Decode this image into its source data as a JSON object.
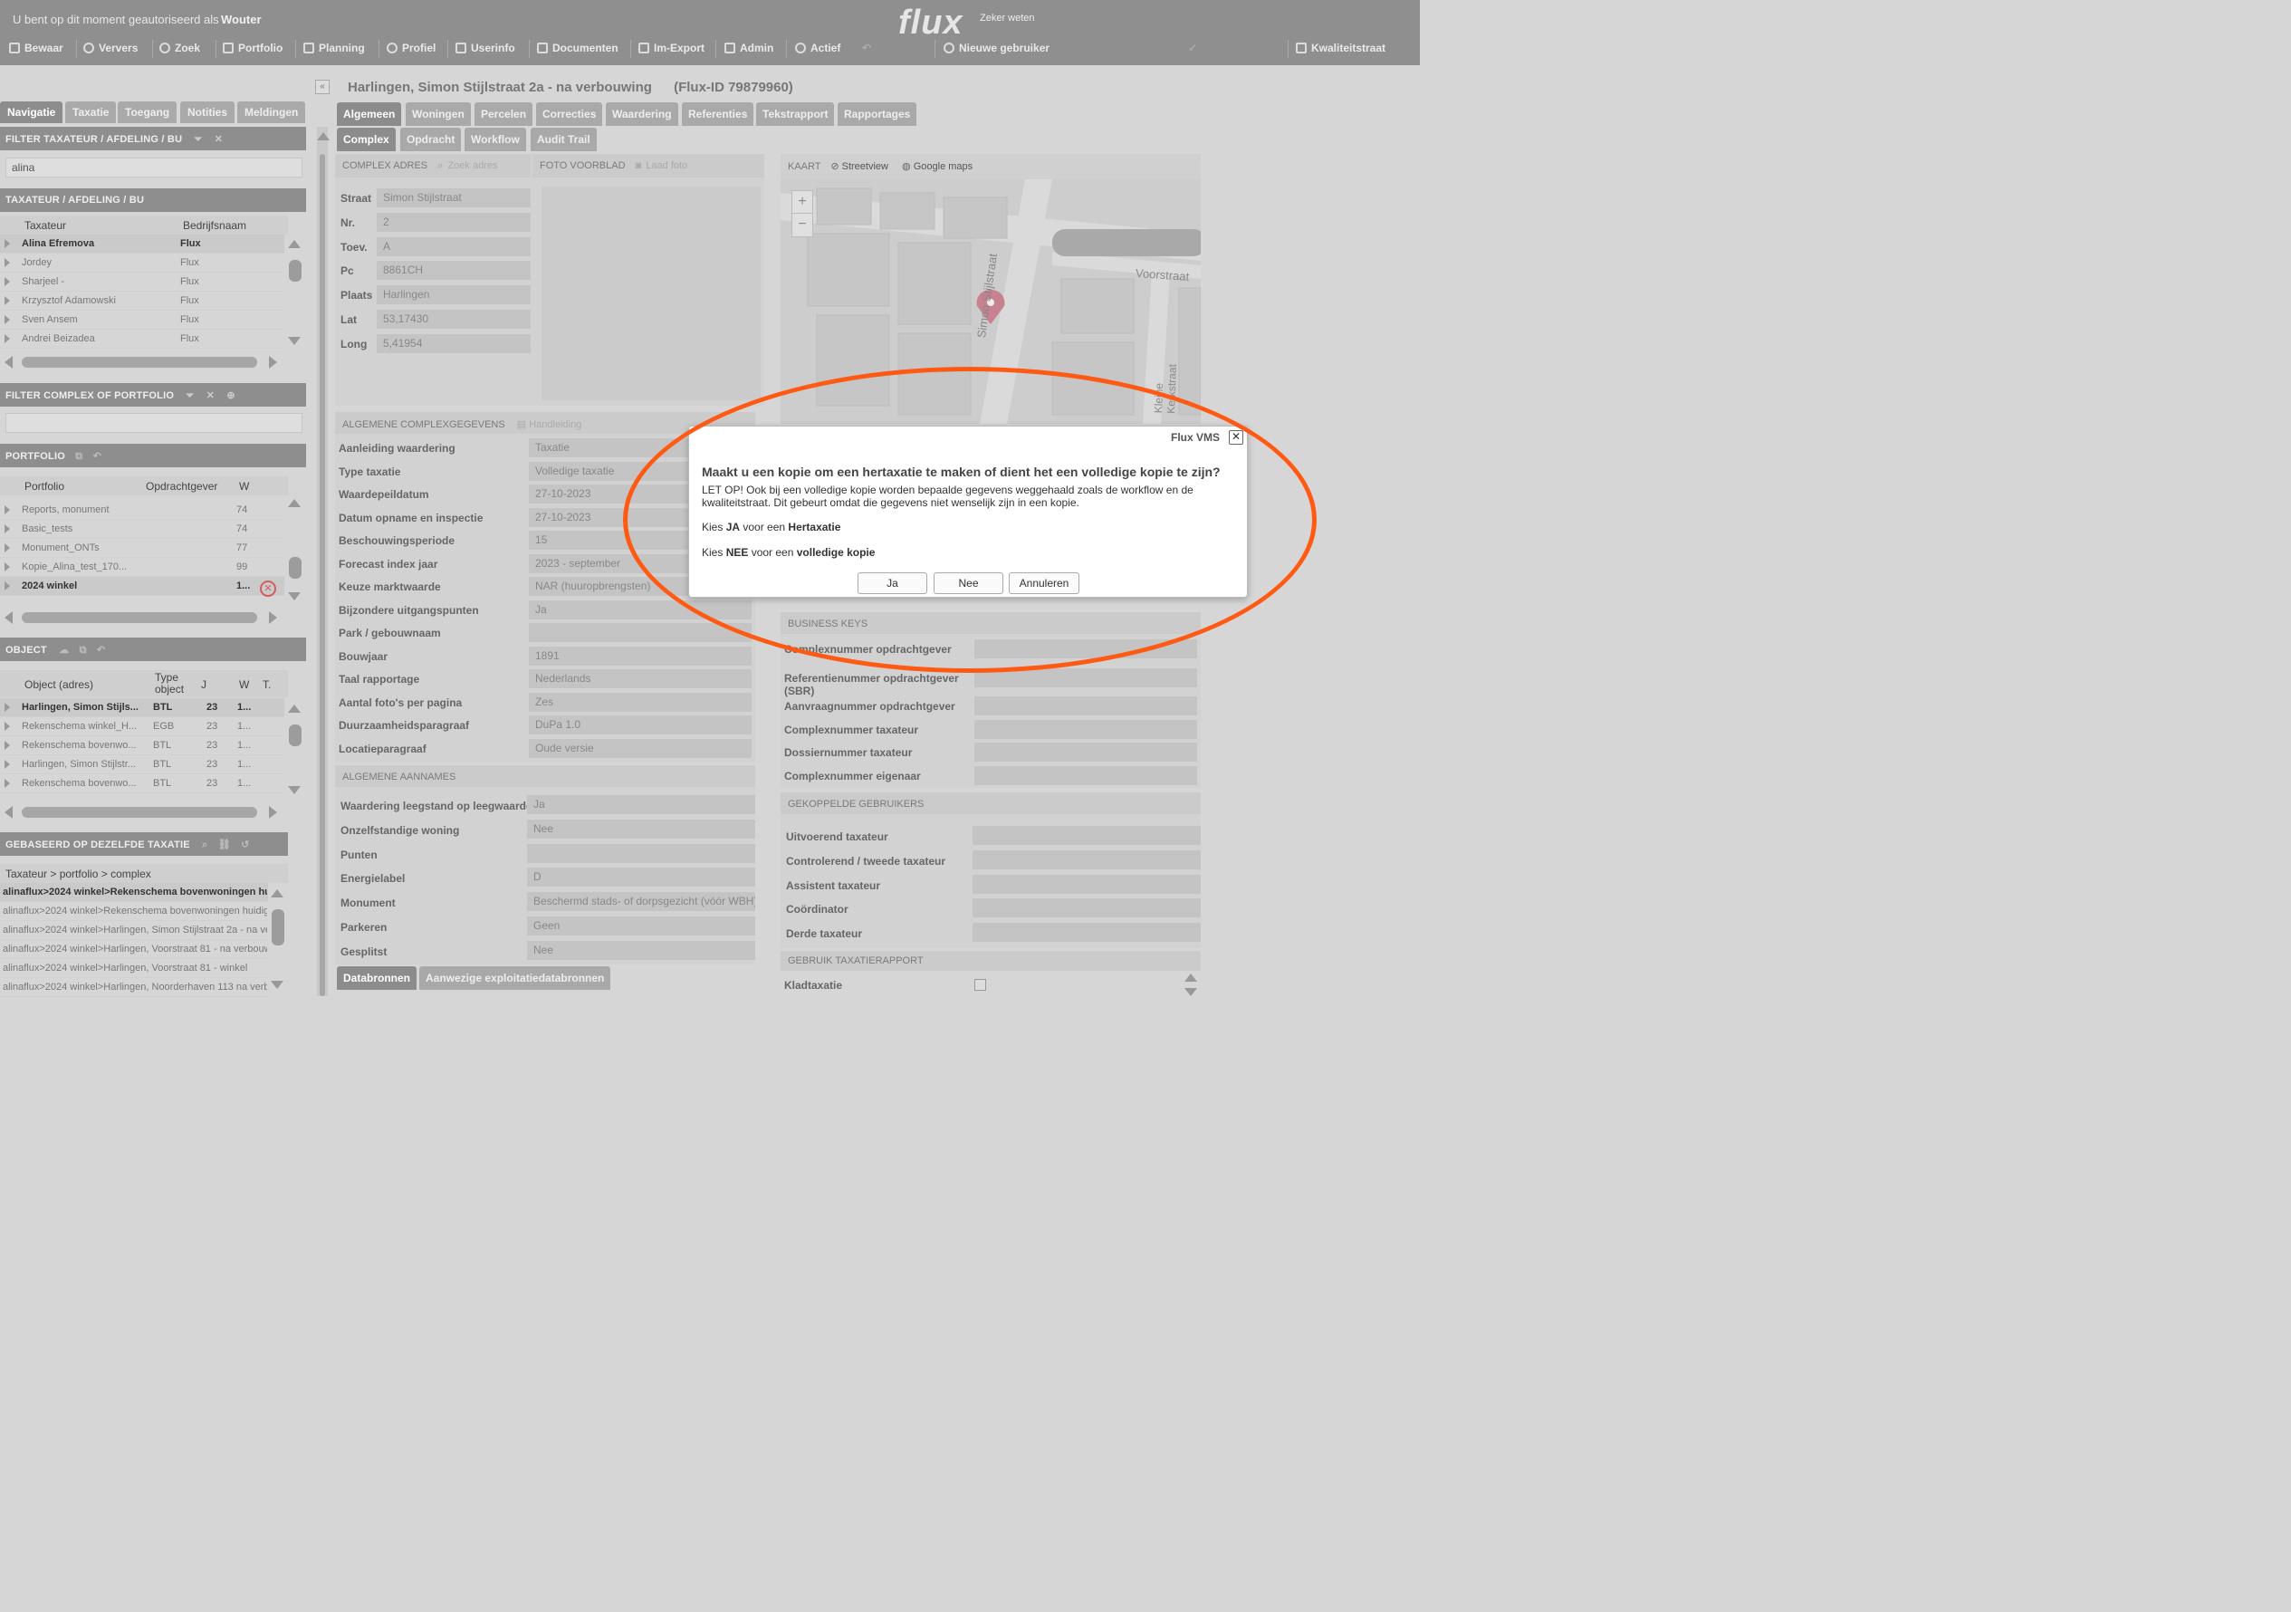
{
  "topbar": {
    "auth_text": "U bent op dit moment geautoriseerd als",
    "user": "Wouter",
    "logo": "flux",
    "tagline": "Zeker weten",
    "menu": [
      "Bewaar",
      "Ververs",
      "Zoek",
      "Portfolio",
      "Planning",
      "Profiel",
      "Userinfo",
      "Documenten",
      "Im-Export",
      "Admin",
      "Actief"
    ],
    "new_user": "Nieuwe gebruiker",
    "quality": "Kwaliteitstraat"
  },
  "left": {
    "tabs": [
      "Navigatie",
      "Taxatie",
      "Toegang",
      "Notities",
      "Meldingen"
    ],
    "filter_taxateur": {
      "header": "FILTER TAXATEUR / AFDELING / BU",
      "value": "alina"
    },
    "taxateur": {
      "header": "TAXATEUR / AFDELING / BU",
      "columns": [
        "Taxateur",
        "Bedrijfsnaam"
      ],
      "rows": [
        [
          "Alina Efremova",
          "Flux"
        ],
        [
          "Jordey",
          "Flux"
        ],
        [
          "Sharjeel -",
          "Flux"
        ],
        [
          "Krzysztof Adamowski",
          "Flux"
        ],
        [
          "Sven Ansem",
          "Flux"
        ],
        [
          "Andrei Beizadea",
          "Flux"
        ]
      ]
    },
    "filter_complex": {
      "header": "FILTER COMPLEX OF PORTFOLIO",
      "value": ""
    },
    "portfolio": {
      "header": "PORTFOLIO",
      "columns": [
        "Portfolio",
        "Opdrachtgever",
        "W"
      ],
      "rows": [
        [
          "Reports, monument",
          "",
          "74"
        ],
        [
          "Basic_tests",
          "",
          "74"
        ],
        [
          "Monument_ONTs",
          "",
          "77"
        ],
        [
          "Kopie_Alina_test_170...",
          "",
          "99"
        ],
        [
          "2024 winkel",
          "",
          "1..."
        ]
      ]
    },
    "object": {
      "header": "OBJECT",
      "columns": [
        "Object (adres)",
        "Type object",
        "J",
        "W",
        "T."
      ],
      "rows": [
        [
          "Harlingen, Simon Stijls...",
          "BTL",
          "23",
          "1..."
        ],
        [
          "Rekenschema winkel_H...",
          "EGB",
          "23",
          "1..."
        ],
        [
          "Rekenschema bovenwo...",
          "BTL",
          "23",
          "1..."
        ],
        [
          "Harlingen, Simon Stijlstr...",
          "BTL",
          "23",
          "1..."
        ],
        [
          "Rekenschema bovenwo...",
          "BTL",
          "23",
          "1..."
        ]
      ]
    },
    "based": {
      "header": "GEBASEERD OP DEZELFDE TAXATIE",
      "column": "Taxateur > portfolio > complex",
      "rows": [
        "alinaflux>2024 winkel>Rekenschema bovenwoningen hu",
        "alinaflux>2024 winkel>Rekenschema bovenwoningen huidig",
        "alinaflux>2024 winkel>Harlingen, Simon Stijlstraat 2a - na ve",
        "alinaflux>2024 winkel>Harlingen, Voorstraat 81 - na verbouw",
        "alinaflux>2024 winkel>Harlingen, Voorstraat 81 - winkel",
        "alinaflux>2024 winkel>Harlingen, Noorderhaven 113 na verb"
      ]
    }
  },
  "main": {
    "title": "Harlingen, Simon Stijlstraat 2a - na verbouwing",
    "flux_id": "(Flux-ID 79879960)",
    "tabs1": [
      "Algemeen",
      "Woningen",
      "Percelen",
      "Correcties",
      "Waardering",
      "Referenties",
      "Tekstrapport",
      "Rapportages"
    ],
    "tabs2": [
      "Complex",
      "Opdracht",
      "Workflow",
      "Audit Trail"
    ],
    "adres": {
      "header": "COMPLEX ADRES",
      "search_placeholder": "Zoek adres",
      "foto_header": "FOTO VOORBLAD",
      "foto_action": "Laad foto",
      "fields": [
        [
          "Straat",
          "Simon Stijlstraat"
        ],
        [
          "Nr.",
          "2"
        ],
        [
          "Toev.",
          "A"
        ],
        [
          "Pc",
          "8861CH"
        ],
        [
          "Plaats",
          "Harlingen"
        ],
        [
          "Lat",
          "53,17430"
        ],
        [
          "Long",
          "5,41954"
        ]
      ]
    },
    "kaart": {
      "header": "KAART",
      "streetview": "Streetview",
      "google": "Google maps",
      "street1": "Voorstraat",
      "street2": "Simon Stijlstraat",
      "street3": "Kleine Kerkstraat",
      "zoom_in": "+",
      "zoom_out": "−"
    },
    "algemeen": {
      "header": "ALGEMENE COMPLEXGEGEVENS",
      "handleiding": "Handleiding",
      "fields": [
        [
          "Aanleiding waardering",
          "Taxatie"
        ],
        [
          "Type taxatie",
          "Volledige taxatie"
        ],
        [
          "Waardepeildatum",
          "27-10-2023"
        ],
        [
          "Datum opname en inspectie",
          "27-10-2023"
        ],
        [
          "Beschouwingsperiode",
          "15"
        ],
        [
          "Forecast index jaar",
          "2023 - september"
        ],
        [
          "Keuze marktwaarde",
          "NAR (huuropbrengsten)"
        ],
        [
          "Bijzondere uitgangspunten",
          "Ja"
        ],
        [
          "Park / gebouwnaam",
          ""
        ],
        [
          "Bouwjaar",
          "1891"
        ],
        [
          "Taal rapportage",
          "Nederlands"
        ],
        [
          "Aantal foto's per pagina",
          "Zes"
        ],
        [
          "Duurzaamheidsparagraaf",
          "DuPa 1.0"
        ],
        [
          "Locatieparagraaf",
          "Oude versie"
        ]
      ]
    },
    "aannames": {
      "header": "ALGEMENE AANNAMES",
      "fields": [
        [
          "Waardering leegstand op leegwaarde",
          "Ja"
        ],
        [
          "Onzelfstandige woning",
          "Nee"
        ],
        [
          "Punten",
          ""
        ],
        [
          "Energielabel",
          "D"
        ],
        [
          "Monument",
          "Beschermd stads- of dorpsgezicht (vóór WBH)"
        ],
        [
          "Parkeren",
          "Geen"
        ],
        [
          "Gesplitst",
          "Nee"
        ]
      ]
    },
    "bottom_tabs": [
      "Databronnen",
      "Aanwezige exploitatiedatabronnen"
    ],
    "business": {
      "header": "BUSINESS KEYS",
      "fields": [
        "Complexnummer opdrachtgever",
        "Referentienummer opdrachtgever (SBR)",
        "Aanvraagnummer opdrachtgever",
        "Complexnummer taxateur",
        "Dossiernummer taxateur",
        "Complexnummer eigenaar"
      ]
    },
    "gekoppeld": {
      "header": "GEKOPPELDE GEBRUIKERS",
      "fields": [
        "Uitvoerend taxateur",
        "Controlerend / tweede taxateur",
        "Assistent taxateur",
        "Coördinator",
        "Derde taxateur"
      ]
    },
    "rapport": {
      "header": "GEBRUIK TAXATIERAPPORT",
      "kladtaxatie": "Kladtaxatie"
    }
  },
  "dialog": {
    "title": "Flux VMS",
    "close": "✕",
    "question": "Maakt u een kopie om een hertaxatie te maken of dient het een volledige kopie te zijn?",
    "message": "LET OP! Ook bij een volledige kopie worden bepaalde gegevens weggehaald zoals de workflow en de kwaliteitstraat. Dit gebeurt omdat die gegevens niet wenselijk zijn in een kopie.",
    "line1_pre": "Kies ",
    "line1_key": "JA",
    "line1_mid": " voor een ",
    "line1_val": "Hertaxatie",
    "line2_pre": "Kies ",
    "line2_key": "NEE",
    "line2_mid": " voor een ",
    "line2_val": "volledige kopie",
    "buttons": [
      "Ja",
      "Nee",
      "Annuleren"
    ]
  },
  "colors": {
    "annotation": "#ff5a14",
    "topbar": "#8f8f8f"
  },
  "icons": [
    "save-icon",
    "refresh-icon",
    "search-icon",
    "portfolio-icon",
    "calendar-icon",
    "user-icon",
    "userinfo-icon",
    "documents-icon",
    "import-export-icon",
    "admin-icon",
    "active-icon",
    "undo-icon",
    "add-user-icon",
    "quality-icon",
    "filter-icon",
    "clear-icon",
    "zoom-icon",
    "camera-icon",
    "streetview-icon",
    "globe-icon",
    "map-pin-icon",
    "close-icon"
  ]
}
